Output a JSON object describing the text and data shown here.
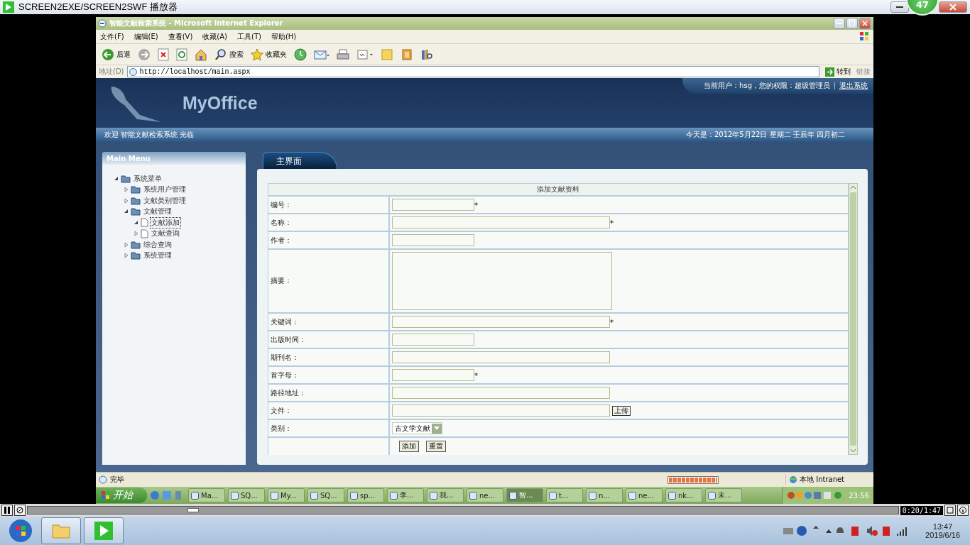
{
  "player": {
    "title": "SCREEN2EXE/SCREEN2SWF 播放器",
    "badge": "47",
    "time": "0:20/1:47",
    "level": 0.19
  },
  "ie": {
    "title": "智能文献检索系统 - Microsoft Internet Explorer",
    "menu": [
      "文件(F)",
      "编辑(E)",
      "查看(V)",
      "收藏(A)",
      "工具(T)",
      "帮助(H)"
    ],
    "toolbar": [
      {
        "kind": "back",
        "label": "后退"
      },
      {
        "kind": "forward"
      },
      {
        "kind": "stop"
      },
      {
        "kind": "refresh"
      },
      {
        "kind": "home"
      },
      {
        "kind": "search",
        "label": "搜索"
      },
      {
        "kind": "favorites",
        "label": "收藏夹"
      },
      {
        "kind": "history"
      },
      {
        "kind": "mail"
      },
      {
        "kind": "print"
      },
      {
        "kind": "edit"
      },
      {
        "kind": "note"
      },
      {
        "kind": "folder"
      },
      {
        "kind": "tool"
      }
    ],
    "address": {
      "label": "地址(D)",
      "value": "http://localhost/main.aspx",
      "go": "转到",
      "links": "链接"
    }
  },
  "page": {
    "logo": "MyOffice",
    "user_info": "当前用户：hsg，您的权限：超级管理员",
    "logout": "退出系统",
    "welcome": "欢迎 智能文献检索系统 光临",
    "date": "今天是：2012年5月22日 星期二 壬辰年 四月初二",
    "sidebar": {
      "title": "Main Menu",
      "tree": [
        {
          "label": "系统菜单",
          "kind": "folder",
          "expanded": true,
          "selected": false,
          "children": [
            {
              "label": "系统用户管理",
              "kind": "folder",
              "expanded": false,
              "selected": false
            },
            {
              "label": "文献类别管理",
              "kind": "folder",
              "expanded": false,
              "selected": false
            },
            {
              "label": "文献管理",
              "kind": "folder",
              "expanded": true,
              "selected": false,
              "children": [
                {
                  "label": "文献添加",
                  "kind": "file",
                  "expanded": true,
                  "selected": true
                },
                {
                  "label": "文献查询",
                  "kind": "file",
                  "expanded": false,
                  "selected": false
                }
              ]
            },
            {
              "label": "综合查询",
              "kind": "folder",
              "expanded": false,
              "selected": false
            },
            {
              "label": "系统管理",
              "kind": "folder",
              "expanded": false,
              "selected": false
            }
          ]
        }
      ]
    },
    "tab": {
      "label": "主界面",
      "selected": true
    },
    "form": {
      "title": "添加文献资料",
      "fields": [
        {
          "label": "编号：",
          "kind": "short",
          "note": "*"
        },
        {
          "label": "名称：",
          "kind": "long",
          "note": "*"
        },
        {
          "label": "作者：",
          "kind": "short"
        },
        {
          "label": "摘要：",
          "kind": "textarea"
        },
        {
          "label": "关键词：",
          "kind": "long",
          "note": "*"
        },
        {
          "label": "出版时间：",
          "kind": "short"
        },
        {
          "label": "期刊名：",
          "kind": "long"
        },
        {
          "label": "首字母：",
          "kind": "short",
          "note": "*"
        },
        {
          "label": "路径地址：",
          "kind": "long"
        },
        {
          "label": "文件：",
          "kind": "file",
          "button": "上传"
        },
        {
          "label": "类别：",
          "kind": "select",
          "value": "古文学文献"
        }
      ],
      "buttons": [
        "添加",
        "重置"
      ]
    }
  },
  "status": {
    "text": "完毕",
    "level": 1,
    "zone": "本地 Intranet"
  },
  "xp_taskbar": {
    "start": "开始",
    "tasks": [
      {
        "label": "Ma...",
        "selected": false
      },
      {
        "label": "SQ...",
        "selected": false
      },
      {
        "label": "My...",
        "selected": false
      },
      {
        "label": "SQ...",
        "selected": false
      },
      {
        "label": "sp...",
        "selected": false
      },
      {
        "label": "李...",
        "selected": false
      },
      {
        "label": "我...",
        "selected": false
      },
      {
        "label": "ne...",
        "selected": false
      },
      {
        "label": "智...",
        "selected": true
      },
      {
        "label": "t...",
        "selected": false
      },
      {
        "label": "n...",
        "selected": false
      },
      {
        "label": "ne...",
        "selected": false
      },
      {
        "label": "nk...",
        "selected": false
      },
      {
        "label": "未...",
        "selected": false
      }
    ],
    "clock": "23:56"
  },
  "win7": {
    "time": "13:47",
    "date": "2019/6/16"
  }
}
